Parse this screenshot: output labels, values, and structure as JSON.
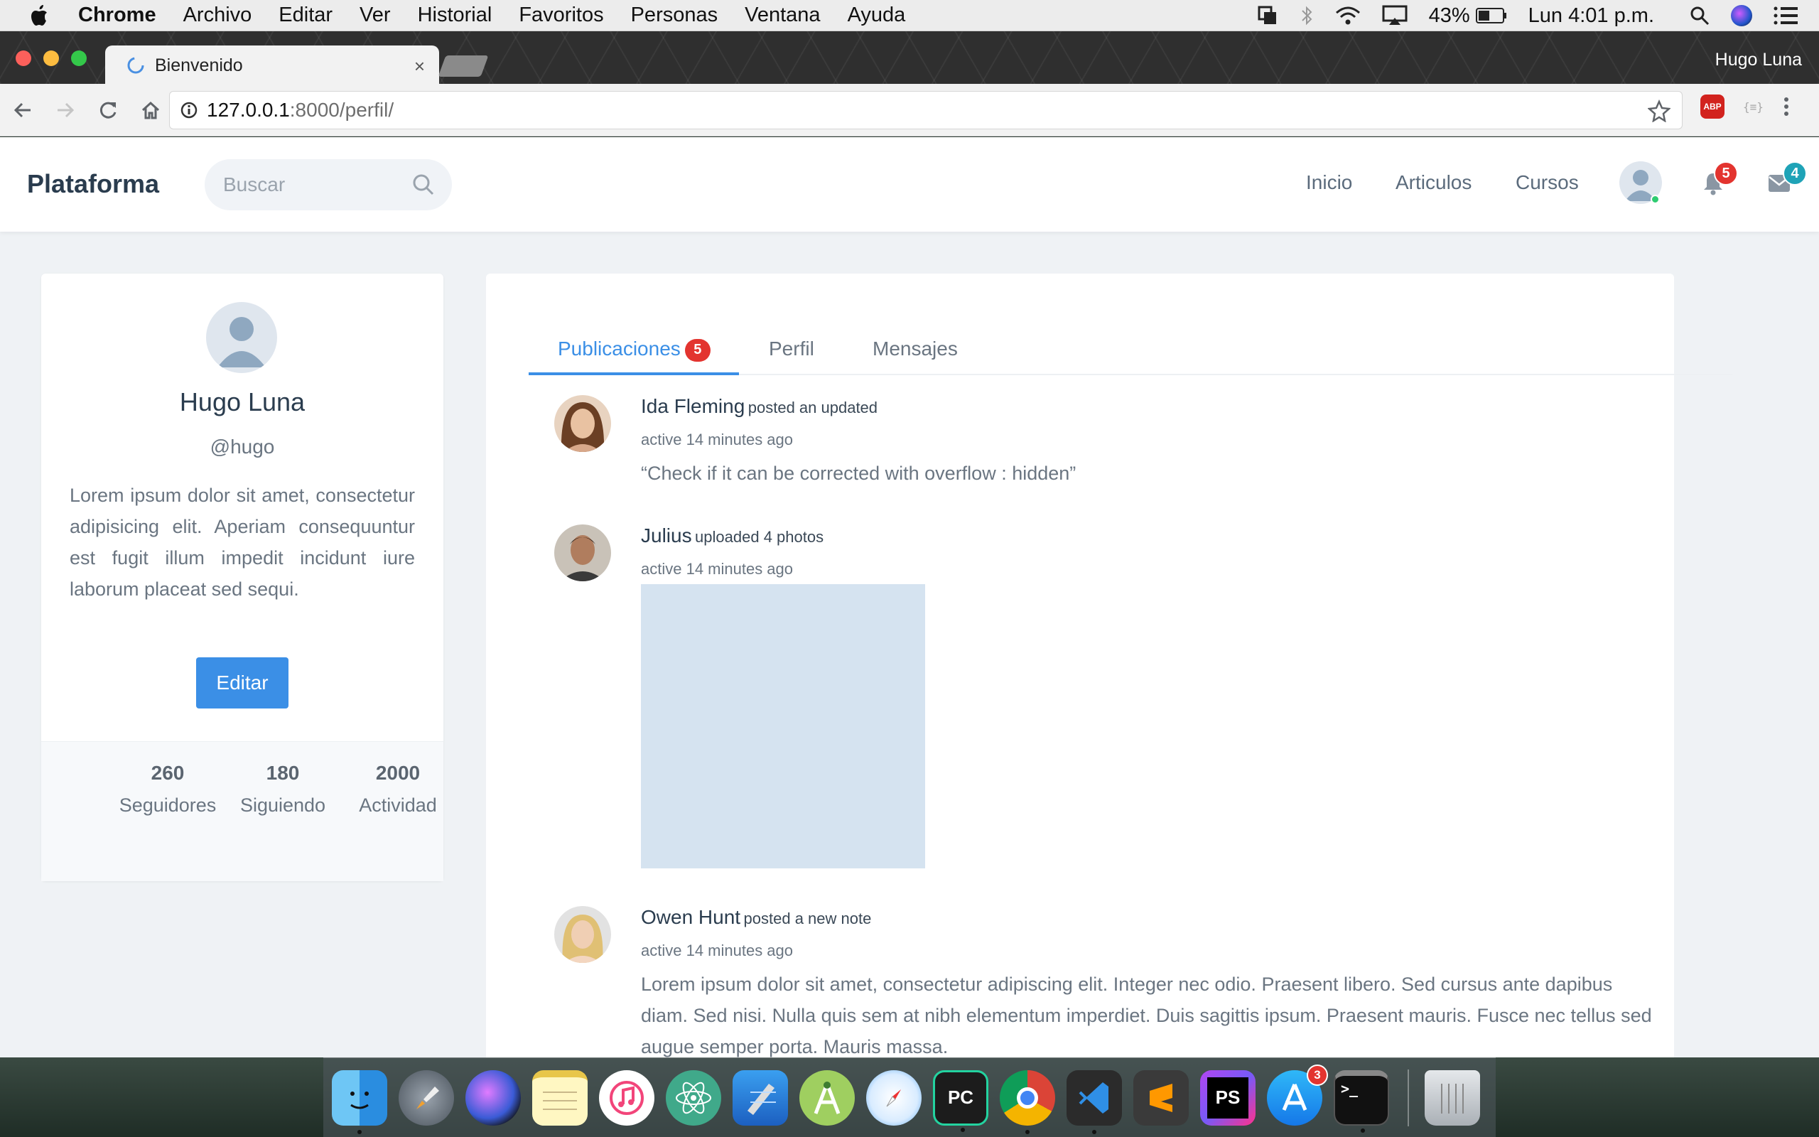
{
  "menubar": {
    "items": [
      "Chrome",
      "Archivo",
      "Editar",
      "Ver",
      "Historial",
      "Favoritos",
      "Personas",
      "Ventana",
      "Ayuda"
    ],
    "battery": "43%",
    "clock": "Lun 4:01 p.m."
  },
  "browser": {
    "tab_title": "Bienvenido",
    "tab_close": "×",
    "profile": "Hugo Luna",
    "url_host": "127.0.0.1",
    "url_path": ":8000/perfil/",
    "ext_abp": "ABP"
  },
  "app": {
    "brand": "Plataforma",
    "search_placeholder": "Buscar",
    "nav": [
      "Inicio",
      "Articulos",
      "Cursos"
    ],
    "notifications_count": "5",
    "messages_count": "4"
  },
  "profile": {
    "name": "Hugo Luna",
    "handle": "@hugo",
    "bio": "Lorem ipsum dolor sit amet, consectetur adipisicing elit. Aperiam consequuntur est fugit illum impedit incidunt iure laborum placeat sed sequi.",
    "edit_label": "Editar",
    "stats": [
      {
        "value": "260",
        "label": "Seguidores"
      },
      {
        "value": "180",
        "label": "Siguiendo"
      },
      {
        "value": "2000",
        "label": "Actividad"
      }
    ]
  },
  "tabs": [
    {
      "label": "Publicaciones",
      "badge": "5"
    },
    {
      "label": "Perfil"
    },
    {
      "label": "Mensajes"
    }
  ],
  "posts": [
    {
      "author": "Ida Fleming",
      "action": "posted an updated",
      "time": "active 14 minutes ago",
      "text": "“Check if it can be corrected with overflow : hidden”"
    },
    {
      "author": "Julius",
      "action": "uploaded 4 photos",
      "time": "active 14 minutes ago"
    },
    {
      "author": "Owen Hunt",
      "action": "posted a new note",
      "time": "active 14 minutes ago",
      "text": "Lorem ipsum dolor sit amet, consectetur adipiscing elit. Integer nec odio. Praesent libero. Sed cursus ante dapibus diam. Sed nisi. Nulla quis sem at nibh elementum imperdiet. Duis sagittis ipsum. Praesent mauris. Fusce nec tellus sed augue semper porta. Mauris massa."
    }
  ],
  "dock": {
    "pycharm": "PC",
    "phpstorm": "PS",
    "terminal": ">_",
    "appstore_badge": "3"
  },
  "colors": {
    "accent": "#3b8fe6",
    "badge_red": "#e3342f",
    "badge_teal": "#1fa3b7",
    "online": "#2ecc71"
  }
}
